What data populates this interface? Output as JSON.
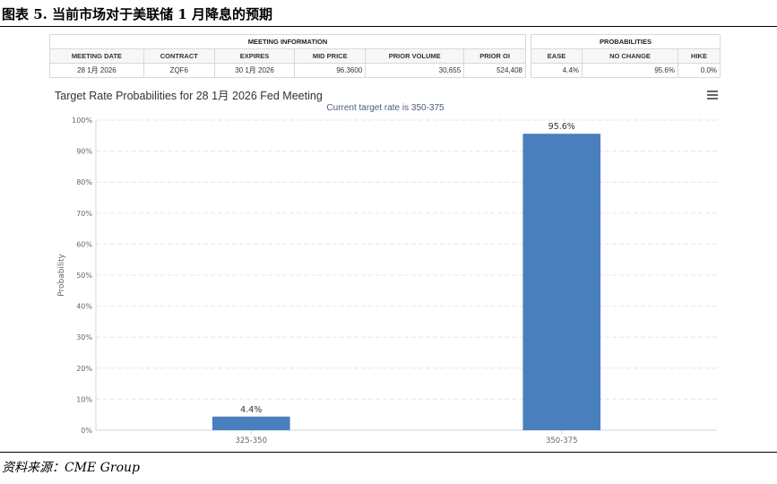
{
  "figure_title": "图表 5. 当前市场对于美联储 1 月降息的预期",
  "source": "资料来源：CME Group",
  "meeting_info": {
    "header": "MEETING INFORMATION",
    "columns": [
      "MEETING DATE",
      "CONTRACT",
      "EXPIRES",
      "MID PRICE",
      "PRIOR VOLUME",
      "PRIOR OI"
    ],
    "values": [
      "28 1月 2026",
      "ZQF6",
      "30 1月 2026",
      "96.3600",
      "30,655",
      "524,408"
    ]
  },
  "probabilities": {
    "header": "PROBABILITIES",
    "columns": [
      "EASE",
      "NO CHANGE",
      "HIKE"
    ],
    "values": [
      "4.4%",
      "95.6%",
      "0.0%"
    ]
  },
  "chart_header": {
    "title": "Target Rate Probabilities for 28 1月 2026 Fed Meeting",
    "subtitle": "Current target rate is 350-375",
    "menu_icon": "hamburger-menu-icon"
  },
  "chart_data": {
    "type": "bar",
    "categories": [
      "325-350",
      "350-375"
    ],
    "values": [
      4.4,
      95.6
    ],
    "data_labels": [
      "4.4%",
      "95.6%"
    ],
    "ylabel": "Probability",
    "ylim": [
      0,
      100
    ],
    "yticks": [
      0,
      10,
      20,
      30,
      40,
      50,
      60,
      70,
      80,
      90,
      100
    ],
    "ytick_labels": [
      "0%",
      "10%",
      "20%",
      "30%",
      "40%",
      "50%",
      "60%",
      "70%",
      "80%",
      "90%",
      "100%"
    ],
    "grid": true,
    "bar_color": "#4a7fbd"
  }
}
